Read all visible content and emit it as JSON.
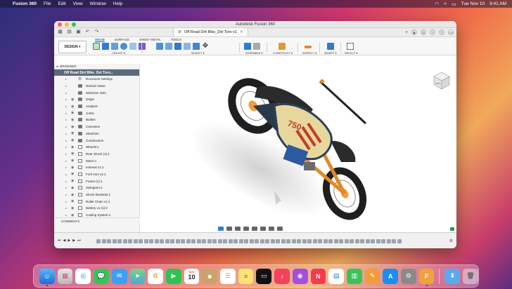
{
  "menubar": {
    "app_name": "Fusion 360",
    "items": [
      "File",
      "Edit",
      "View",
      "Window",
      "Help"
    ],
    "date": "Tue Nov 10",
    "time": "9:41 AM"
  },
  "window": {
    "title": "Autodesk Fusion 360",
    "doc_tab": "Off Road Dirt Bike_Del Toro v1"
  },
  "ribbon": {
    "workspace": "DESIGN ▾",
    "tabs": [
      "SOLID",
      "SURFACE",
      "SHEET METAL",
      "TOOLS"
    ],
    "active_tab": "SOLID",
    "groups": {
      "create": "CREATE ▾",
      "modify": "MODIFY ▾",
      "assemble": "ASSEMBLE ▾",
      "construct": "CONSTRUCT ▾",
      "inspect": "INSPECT ▾",
      "insert": "INSERT ▾",
      "select": "SELECT ▾"
    }
  },
  "browser": {
    "header": "BROWSER",
    "root": "Off Road Dirt Bike_Del Toro...",
    "items": [
      "Document Settings",
      "Named Views",
      "Selection Sets",
      "Origin",
      "Analysis",
      "Joints",
      "Bodies",
      "Canvases",
      "Sketches",
      "Construction",
      "Wheels:1",
      "Rear Shock (1):1",
      "Motor:1",
      "exhaust v1:1",
      "Fork Asm v1:1",
      "Frame (1):1",
      "Swingarm:1",
      "Shock Brackets:1",
      "Roller Chain v1:1",
      "Battery v1 (1):2",
      "Cooling System:1"
    ],
    "comments": "COMMENTS"
  },
  "viewcube": {
    "label": "LEFT"
  },
  "bike": {
    "number": "750"
  },
  "dock": {
    "calendar_month": "NOV",
    "calendar_day": "10",
    "apps": [
      "finder",
      "launchpad",
      "safari",
      "messages",
      "mail",
      "maps",
      "photos",
      "facetime",
      "calendar",
      "contacts",
      "reminders",
      "notes",
      "tv",
      "music",
      "podcasts",
      "news",
      "numbers",
      "keynote",
      "pages",
      "app-store",
      "system-preferences",
      "fusion-360",
      "downloads",
      "trash"
    ]
  }
}
